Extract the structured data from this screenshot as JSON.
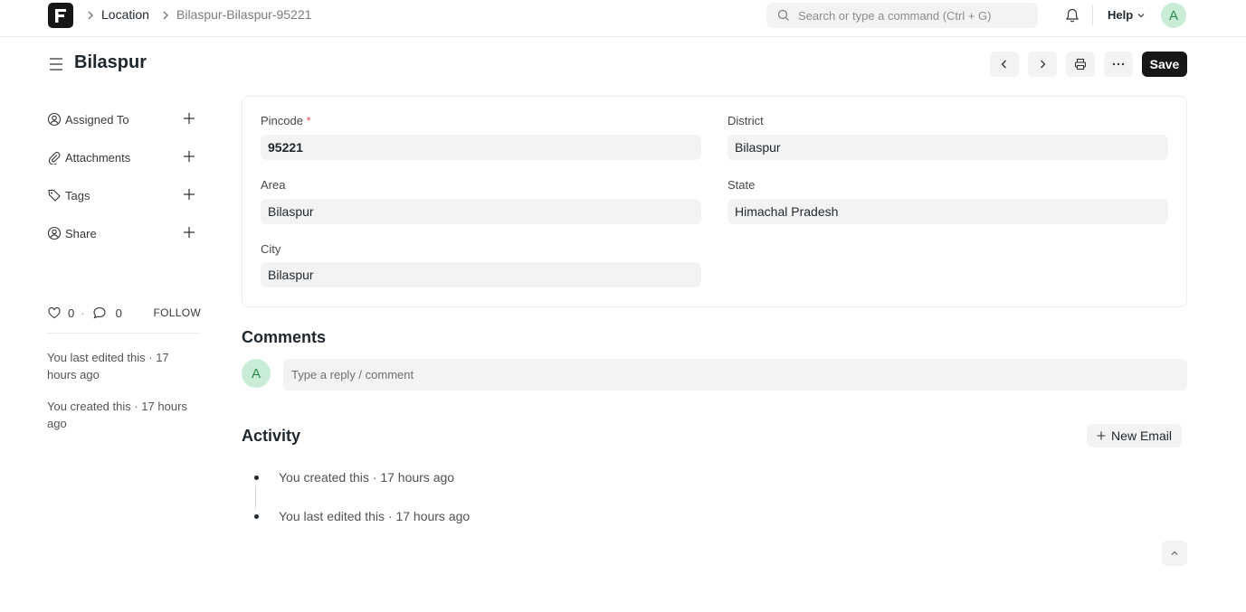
{
  "navbar": {
    "logo_letter": "F",
    "breadcrumbs": [
      "Location",
      "Bilaspur-Bilaspur-95221"
    ],
    "search_placeholder": "Search or type a command (Ctrl + G)",
    "help_label": "Help",
    "avatar_initial": "A"
  },
  "page": {
    "title": "Bilaspur",
    "save_label": "Save"
  },
  "sidebar": {
    "items": [
      {
        "label": "Assigned To",
        "icon": "assign-icon"
      },
      {
        "label": "Attachments",
        "icon": "paperclip-icon"
      },
      {
        "label": "Tags",
        "icon": "tag-icon"
      },
      {
        "label": "Share",
        "icon": "share-icon"
      }
    ],
    "likes": "0",
    "comments": "0",
    "follow_label": "FOLLOW",
    "last_edited": "You last edited this · 17 hours ago",
    "created": "You created this · 17 hours ago"
  },
  "form": {
    "pincode": {
      "label": "Pincode",
      "value": "95221",
      "required": "*"
    },
    "district": {
      "label": "District",
      "value": "Bilaspur"
    },
    "area": {
      "label": "Area",
      "value": "Bilaspur"
    },
    "state": {
      "label": "State",
      "value": "Himachal Pradesh"
    },
    "city": {
      "label": "City",
      "value": "Bilaspur"
    }
  },
  "comments": {
    "title": "Comments",
    "avatar_initial": "A",
    "placeholder": "Type a reply / comment"
  },
  "activity": {
    "title": "Activity",
    "new_email_label": "New Email",
    "items": [
      "You created this · 17 hours ago",
      "You last edited this · 17 hours ago"
    ]
  },
  "colors": {
    "primary_button": "#171717",
    "avatar_bg": "#c9ecd6",
    "avatar_fg": "#2b8a4a",
    "required": "#e24c4c"
  }
}
